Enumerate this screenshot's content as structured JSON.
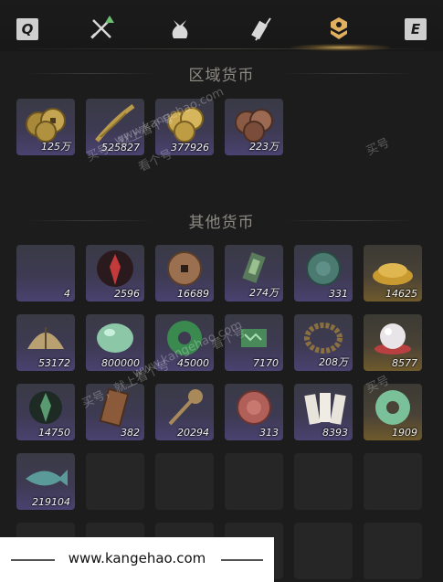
{
  "topbar": {
    "left_key": "Q",
    "right_key": "E",
    "tabs": [
      {
        "icon": "crossed-swords-icon"
      },
      {
        "icon": "pouch-icon"
      },
      {
        "icon": "scroll-brush-icon"
      },
      {
        "icon": "currency-badge-icon",
        "active": true
      }
    ]
  },
  "sections": {
    "regional": {
      "title": "区域货币"
    },
    "other": {
      "title": "其他货币"
    }
  },
  "regional_items": [
    {
      "icon": "gold-coin-pile-icon",
      "qty": "125万"
    },
    {
      "icon": "coin-string-icon",
      "qty": "525827"
    },
    {
      "icon": "gold-coin-stack-icon",
      "qty": "377926"
    },
    {
      "icon": "copper-coin-pile-icon",
      "qty": "223万"
    }
  ],
  "other_items": [
    {
      "icon": "crescent-jade-icon",
      "qty": "4"
    },
    {
      "icon": "red-crystal-icon",
      "qty": "2596"
    },
    {
      "icon": "bronze-coin-icon",
      "qty": "16689"
    },
    {
      "icon": "jade-token-icon",
      "qty": "274万"
    },
    {
      "icon": "green-stone-coin-icon",
      "qty": "331"
    },
    {
      "icon": "gold-ingot-pile-icon",
      "qty": "14625"
    },
    {
      "icon": "shell-coin-icon",
      "qty": "53172"
    },
    {
      "icon": "jade-pebble-icon",
      "qty": "800000"
    },
    {
      "icon": "jade-disc-icon",
      "qty": "45000"
    },
    {
      "icon": "jade-tally-icon",
      "qty": "7170"
    },
    {
      "icon": "bead-bracelet-icon",
      "qty": "208万"
    },
    {
      "icon": "pearl-icon",
      "qty": "8577"
    },
    {
      "icon": "green-crystal-icon",
      "qty": "14750"
    },
    {
      "icon": "bronze-plaque-icon",
      "qty": "382"
    },
    {
      "icon": "spade-coin-icon",
      "qty": "20294"
    },
    {
      "icon": "red-seal-icon",
      "qty": "313"
    },
    {
      "icon": "paper-notes-icon",
      "qty": "8393"
    },
    {
      "icon": "jade-bi-ring-icon",
      "qty": "1909"
    },
    {
      "icon": "jade-fish-icon",
      "qty": "219104"
    }
  ],
  "watermark": {
    "texts": [
      "买号，就上看个号",
      "www.kangehao.com",
      "看个号",
      "买号",
      "买号，就上看个号",
      "www.kangehao.com",
      "看个号",
      "买号"
    ]
  },
  "footer": {
    "url": "www.kangehao.com"
  },
  "colors": {
    "accent": "#e0b060",
    "slot_purple": "#4a4270",
    "slot_gold": "#6e5a2c"
  }
}
